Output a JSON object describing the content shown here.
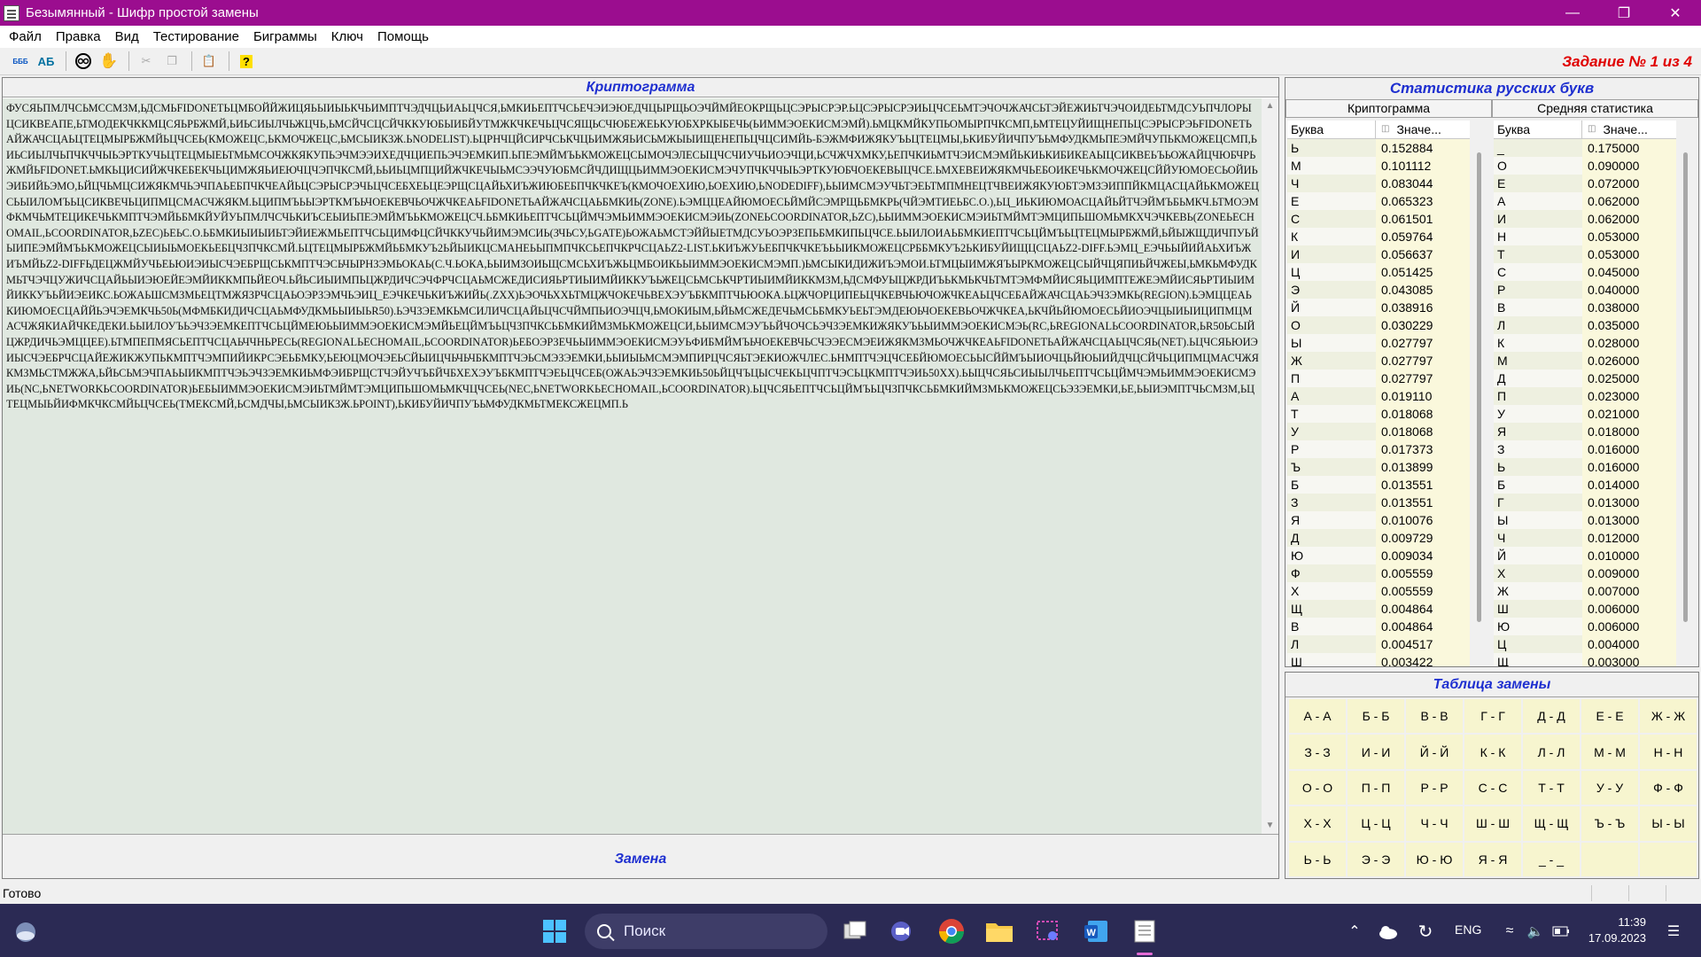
{
  "window": {
    "title": "Безымянный - Шифр простой замены"
  },
  "menu": [
    "Файл",
    "Правка",
    "Вид",
    "Тестирование",
    "Биграммы",
    "Ключ",
    "Помощь"
  ],
  "toolbar": {
    "btn1": "БББ",
    "btn2": "АБ",
    "task_label": "Задание № 1 из 4"
  },
  "crypto": {
    "header": "Криптограмма",
    "text": "ФУСЯЬПМЛЧСЬМССМЗМ,ЬДСМЬFIDONETЬЦМБОЙЙЖИЦЯЬЫИЫЬКЧЬИМПТЧЭДЧЦЬИАЬЦЧСЯ,ЬМКИЬЕПТЧСЬЕЧЭИЭЮЕДЧЦЫРЩЬОЭЧЙМЙЕОКРЩЬЦСЭРЫСРЭР.ЬЦСЭРЫСРЭИЬЦЧСЕЬМТЭЧОЧЖАЧСЬТЭЙЕЖИЬТЧЭЧОИДЕЬТМДСУЬПЧЛОРЫЦСИКВЕАПЕ,ЬТМОДЕКЧККМЦСЯЬРБЖМЙ,ЬИЬСИЫЛЧЬЖЦЧЬ,ЬМСЙЧСЦСЙЧККУЮБЫИБЙУТМЖКЧКЕЧЬЦЧСЯЩЬСЧЮБЕЖЕЬКУЮБХРКЫБЕЧЬ(ЬИММЭОЕКИСМЭМЙ).ЬМЦКМЙКУПЬОМЫРПЧКСМП,ЬМТЕЦУЙИЩНЕПЬЦСЭРЫСРЭЬFIDONETЬАЙЖАЧСЦАЬЦТЕЦМЫРБЖМЙЬЦЧСЕЬ(КМОЖЕЦС,ЬКМОЧЖЕЦС,ЬМСЫИКЗЖ.ЬNODELIST).ЬЦРНЧЦЙСИРЧСЬКЧЦЬИМЖЯЬИСЬМЖЫЫИЩЕНЕПЬЦЧЦСИМЙЬ-БЭЖМФИЖЯКУЪЬЦТЕЦМЫ,ЬКИБУЙИЧПУЪЬМФУДКМЬПЕЭМЙЧУПЬКМОЖЕЦСМП,ЬИЬСИЫЛЧЬПЧКЧЧЫЬЭРТКУЧЬЦТЕЦМЫЕЬТМЬМСОЧЖКЯКУПЬЭЧМЭЭИХЕДЧЦИЕПЬЭЧЭЕМКИП.ЬПЕЭМЙМЪЬКМОЖЕЦСЫМОЧЭЛЕСЫЦЧСЧИУЧЬИОЭЧЦИ,ЬСЧЖЧХМКУ,ЬЕПЧКИЬМТЧЭИСМЭМЙЬКИЬКИБИКЕАЫЦСИКВЕЬЪЬОЖАЙЦЧЮБЧРЬЖМЙЬFIDONET.ЬМКЬЦИСИЙЖЧКЕБЕКЧЬЦИМЖЯЬИЕЮЧЦЧЭПЧКСМЙ,ЬЬИЬЦМПЦИЙЖЧКЕЧЫЬМСЭЭЧУЮБМСЙЧДИЩЦЬИММЭОЕКИСМЭЧУПЧКЧЧЫЬЭРТКУЮБЧОЕКЕВЫЦЧСЕ.ЬМХЕВЕИЖЯКМЧЬЕБОИКЕЧЬКМОЧЖЕЦСЙЙУЮМОЕСЬОЙИЬЭИБИЙЬЭМО,ЬЙЦЧЬМЦСИЖЯКМЧЬЭЧПАЬЕБПЧКЧЕАЙЬЦСЭРЫСРЭЧЬЦЧСЕБХЕЬЦЕЭРЩСЦАЙЬХИЪЖИЮБЕБПЧКЧКЕЪ(КМОЧОЕХИЮ,ЬОЕХИЮ,ЬNODEDIFF),ЬЫИМСМЭУЧЬТЭЕЬТМПМНЕЦТЧВЕИЖЯКУЮБТЭМЗЭИППЙКМЦАСЦАЙЬКМОЖЕЦСЬЫИЛОМЪЬЦСИКВЕЧЬЦИПМЦСМАСЧЖЯКМ.ЬЦИПМЪЬЫЭРТКМЪЬЧОЕКЕВЧЬОЧЖЧКЕАЬFIDONETЬАЙЖАЧСЦАЬБМКИЬ(ZONE).ЬЭМЦЦЕАЙЮМОЕСЬЙМЙСЭМРЩЬБМКРЬ(ЧЙЭМТИЕЬБС.О.),ЬЦ_ИЬКИЮМОАСЦАЙЬЙТЧЭЙМЪБЬМКЧ.ЬТМОЭМФКМЧЬМТЕЦИКЕЧЬКМПТЧЭМЙЬБМКЙУЙУЬПМЛЧСЧЬКИЪСЕЫИЬПЕЭМЙМЪЬКМОЖЕЦСЧ.ЬБМКИЬЕПТЧСЬЦЙМЧЭМЬИММЭОЕКИСМЭИЬ(ZONEЬCOORDINATOR,ЬZC),ЬЫИММЭОЕКИСМЭИЬТМЙМТЭМЦИПЬШОМЬМКХЧЭЧКЕВЬ(ZONEЬЕСНОМАIL,ЬCOORDINATOR,ЬZEC)ЬЕЬС.О.ЬБМКИЫИЫИЬТЭЙИЕЖМЬЕПТЧСЬЦИМФЦСЙЧККУЧЬЙИМЭМСИЬ(ЗЧЬСУ,ЬGATE)ЬОЖАЬМСТЭЙЙЫЕТМДСУЬОЭРЗЕПЬБМКИПЬЦЧСЕ.ЬЫИЛОИАЬБМКИЕПТЧСЬЦЙМЪЬЦТЕЦМЫРБЖМЙ,ЬЙЫЖЩДИЧПУЬЙЫИПЕЭМЙМЪЬКМОЖЕЦСЫИЫЬМОЕКЬЕБЦЧЗПЧКСМЙ.ЬЦТЕЦМЫРБЖМЙЬБМКУЪ2ЬЙЫИКЦСМАНЕЬЫПМПЧКСЬЕПЧКРЧСЦАЬZ2-LIST.ЬКИЪЖУЬЕБПЧКЧКЕЪЬЫИКМОЖЕЦСРББМКУЪ2ЬКИБУЙИЩЦСЦАЬZ2-DIFF.ЬЭМЦ_ЕЭЧЬЫЙИЙАЬХИЪЖИЪМЙЬZ2-DIFFЬДЕЦЖМЙУЧЬЕЬЮИЭИЫСЧЭЕБРЩСЬКМПТЧЭСЬЧЫРНЗЭМЬОКАЬ(С.Ч.ЬОКА,ЬЫИМЗОИЬЩСМСЬХИЪЖЬЦМБОИКЬЫИММЭОЕКИСМЭМП.)ЬМСЫКИДИЖИЪЭМОИ.ЬТМЦЫИМЖЯЪЫРКМОЖЕЦСЫЙЧЦЯПИЬЙЧЖЕЫ,ЬМКЬМФУДКМЬТЧЭЧЦУЖИЧСЦАЙЬЫИЭЮЕЙЕЭМЙИККМПЬЙЕОЧ.ЬЙЬСИЫИМПЬЦЖРДИЧСЭЧФРЧСЦАЬМСЖЕДИСИЯЬРТИЫИМЙИККУЪЬЖЕЦСЬМСЬКЧРТИЫИМЙИККМЗМ,ЬДСМФУЫЦЖРДИЪЬКМЬКЧЬТМТЭМФМЙИСЯЬЦИМПТЕЖЕЭМЙИСЯЬРТИЫИМЙИККУЪЬЙИЭЕИКС.ЬОЖАЬШСМЗМЬЕЦТМЖЯЗРЧСЦАЬОЭРЗЭМЧЬЭИЦ_ЕЭЧКЕЧЬКИЪЖИЙЬ(.ZXX)ЬЭОЧЬХХЬТМЦЖЧОКЕЧЬВЕХЭУЪБКМПТЧЬЮОКА.ЬЦЖЧОРЦИПЕЬЦЧКЕВЧЬЮЧОЖЧКЕАЬЦЧСЕБАЙЖАЧСЦАЬЭЧЗЭМКЬ(REGION).ЬЭМЦЦЕАЬКИЮМОЕСЦАЙЙЬЭЧЭЕМКЧЬ50Ь(МФМБКИДИЧСЦАЬМФУДКМЬЫИЫЬR50).ЬЭЧЗЭЕМКЬМСИЛИЧСЦАЙЬЦЧСЧЙМПЬИОЭЧЦЧ,ЬМОКИЫМ,ЬЙЬМСЖЕДЕЧЬМСЬБМКУЬЕЬТЭМДЕЮЬЧОЕКЕВЬОЧЖЧКЕА,ЬКЧЙЬЙЮМОЕСЬЙИОЭЧЦЫИЫИЦИПМЦМАСЧЖЯКИАЙЧКЕДЕКИ.ЬЫИЛОУЪЬЭЧЗЭЕМКЕПТЧСЬЦЙМЕЮЬЫИММЭОЕКИСМЭМЙЬЕЦЙМЪЬЦЧЗПЧКСЬБМКИЙМЗМЬКМОЖЕЦСИ,ЬЫИМСМЭУЪЬЙЧОЧСЬЭЧЗЭЕМКИЖЯКУЪЬЫИММЭОЕКИСМЭЬ(RC,ЬREGIONALЬCOORDINATOR,ЬR50ЬСЫЙЦЖРДИЧЬЭМЦЦЕЕ).ЬТМПЕПМЯСЬЕПТЧСЦАЬЧЧНЬРЕСЬ(REGIONALЬЕСНОМАIL,ЬCOORDINATOR)ЬЕБОЭРЗЕЧЬЫИММЭОЕКИСМЭУЬФИБМЙМЪЬЧОЕКЕВЧЬСЧЭЭЕСМЭЕИЖЯКМЗМЬОЧЖЧКЕАЬFIDONETЬАЙЖАЧСЦАЬЦЧСЯЬ(NET).ЬЦЧСЯЬЮИЭИЫСЧЭЕБРЧСЦАЙЕЖИКЖУПЬКМПТЧЭМПИЙИКРСЭЕЬБМКУ,ЬЕЮЦМОЧЭЕЬСЙЫИЦЧЬЧЬЧБКМПТЧЭЬСМЭЗЭЕМКИ,ЬЫИЫЬМСМЭМПИРЦЧСЯЬТЭЕКИОЖЧЛЕС.ЬНМПТЧЭЦЧСЕБЙЮМОЕСЬЫСЙЙМЪЫИОЧЦЬЙЮЫИЙДЧЦСЙЧЬЦИПМЦМАСЧЖЯКМЗМЬСТМЖЖА,ЬЙЬСЬМЭЧПАЬЫИКМПТЧЭЬЭЧЗЭЕМКИЬМФЭИБРЩСТЧЭЙУЧЪБЙЧБХЕХЭУЪБКМПТЧЭЕЬЦЧСЕБ(ОЖАЬЭЧЗЭЕМКИЬ50ЬЙЦЧЪЦЫСЧЕКЬЦЧПТЧЭСЬЦКМПТЧЭИЬ50XX).ЬЫЦЧСЯЬСИЫЫЛЧЬЕПТЧСЬЦЙМЧЭМЬИММЭОЕКИСМЭИЬ(NC,ЬNETWORKЬCOORDINATOR)ЬЕБЫИММЭОЕКИСМЭИЬТМЙМТЭМЦИПЬШОМЬМКЧЦЧСЕЬ(NEC,ЬNETWORKЬЕСНОМАIL,ЬCOORDINATOR).ЬЦЧСЯЬЕПТЧСЬЦЙМЪЬЦЧЗПЧКСЬБМКИЙМЗМЬКМОЖЕЦСЬЭЗЭЕМКИ,ЬЕ,ЬЫИЭМПТЧЬСМЗМ,ЬЦТЕЦМЫЬЙИФМКЧКСМЙЬЦЧСЕЬ(ТМЕКСМЙ,ЬСМДЧЫ,ЬМСЫИКЗЖ.ЬPOINT),ЬКИБУЙИЧПУЪЬМФУДКМЬТМЕКСЖЕЦМП.Ь",
    "footer": "Замена"
  },
  "stats": {
    "header": "Статистика русских букв",
    "left_title": "Криптограмма",
    "right_title": "Средняя статистика",
    "col_letter": "Буква",
    "col_value": "Значе...",
    "crypto_rows": [
      [
        "Ь",
        "0.152884"
      ],
      [
        "М",
        "0.101112"
      ],
      [
        "Ч",
        "0.083044"
      ],
      [
        "Е",
        "0.065323"
      ],
      [
        "С",
        "0.061501"
      ],
      [
        "К",
        "0.059764"
      ],
      [
        "И",
        "0.056637"
      ],
      [
        "Ц",
        "0.051425"
      ],
      [
        "Э",
        "0.043085"
      ],
      [
        "Й",
        "0.038916"
      ],
      [
        "О",
        "0.030229"
      ],
      [
        "Ы",
        "0.027797"
      ],
      [
        "Ж",
        "0.027797"
      ],
      [
        "П",
        "0.027797"
      ],
      [
        "А",
        "0.019110"
      ],
      [
        "Т",
        "0.018068"
      ],
      [
        "У",
        "0.018068"
      ],
      [
        "Р",
        "0.017373"
      ],
      [
        "Ъ",
        "0.013899"
      ],
      [
        "Б",
        "0.013551"
      ],
      [
        "З",
        "0.013551"
      ],
      [
        "Я",
        "0.010076"
      ],
      [
        "Д",
        "0.009729"
      ],
      [
        "Ю",
        "0.009034"
      ],
      [
        "Ф",
        "0.005559"
      ],
      [
        "Х",
        "0.005559"
      ],
      [
        "Щ",
        "0.004864"
      ],
      [
        "В",
        "0.004864"
      ],
      [
        "Л",
        "0.004517"
      ],
      [
        "Ш",
        "0.003422"
      ]
    ],
    "avg_rows": [
      [
        "_",
        "0.175000"
      ],
      [
        "О",
        "0.090000"
      ],
      [
        "Е",
        "0.072000"
      ],
      [
        "А",
        "0.062000"
      ],
      [
        "И",
        "0.062000"
      ],
      [
        "Н",
        "0.053000"
      ],
      [
        "Т",
        "0.053000"
      ],
      [
        "С",
        "0.045000"
      ],
      [
        "Р",
        "0.040000"
      ],
      [
        "В",
        "0.038000"
      ],
      [
        "Л",
        "0.035000"
      ],
      [
        "К",
        "0.028000"
      ],
      [
        "М",
        "0.026000"
      ],
      [
        "Д",
        "0.025000"
      ],
      [
        "П",
        "0.023000"
      ],
      [
        "У",
        "0.021000"
      ],
      [
        "Я",
        "0.018000"
      ],
      [
        "З",
        "0.016000"
      ],
      [
        "Ь",
        "0.016000"
      ],
      [
        "Б",
        "0.014000"
      ],
      [
        "Г",
        "0.013000"
      ],
      [
        "Ы",
        "0.013000"
      ],
      [
        "Ч",
        "0.012000"
      ],
      [
        "Й",
        "0.010000"
      ],
      [
        "Х",
        "0.009000"
      ],
      [
        "Ж",
        "0.007000"
      ],
      [
        "Ш",
        "0.006000"
      ],
      [
        "Ю",
        "0.006000"
      ],
      [
        "Ц",
        "0.004000"
      ],
      [
        "Щ",
        "0.003000"
      ]
    ]
  },
  "substitution": {
    "header": "Таблица замены",
    "cells": [
      "А - А",
      "Б - Б",
      "В - В",
      "Г - Г",
      "Д - Д",
      "Е - Е",
      "Ж - Ж",
      "З - З",
      "И - И",
      "Й - Й",
      "К - К",
      "Л - Л",
      "М - М",
      "Н - Н",
      "О - О",
      "П - П",
      "Р - Р",
      "С - С",
      "Т - Т",
      "У - У",
      "Ф - Ф",
      "Х - Х",
      "Ц - Ц",
      "Ч - Ч",
      "Ш - Ш",
      "Щ - Щ",
      "Ъ - Ъ",
      "Ы - Ы",
      "Ь - Ь",
      "Э - Э",
      "Ю - Ю",
      "Я - Я",
      "_ - _",
      "",
      ""
    ]
  },
  "status": {
    "text": "Готово"
  },
  "taskbar": {
    "search_placeholder": "Поиск",
    "lang": "ENG",
    "time": "11:39",
    "date": "17.09.2023"
  }
}
